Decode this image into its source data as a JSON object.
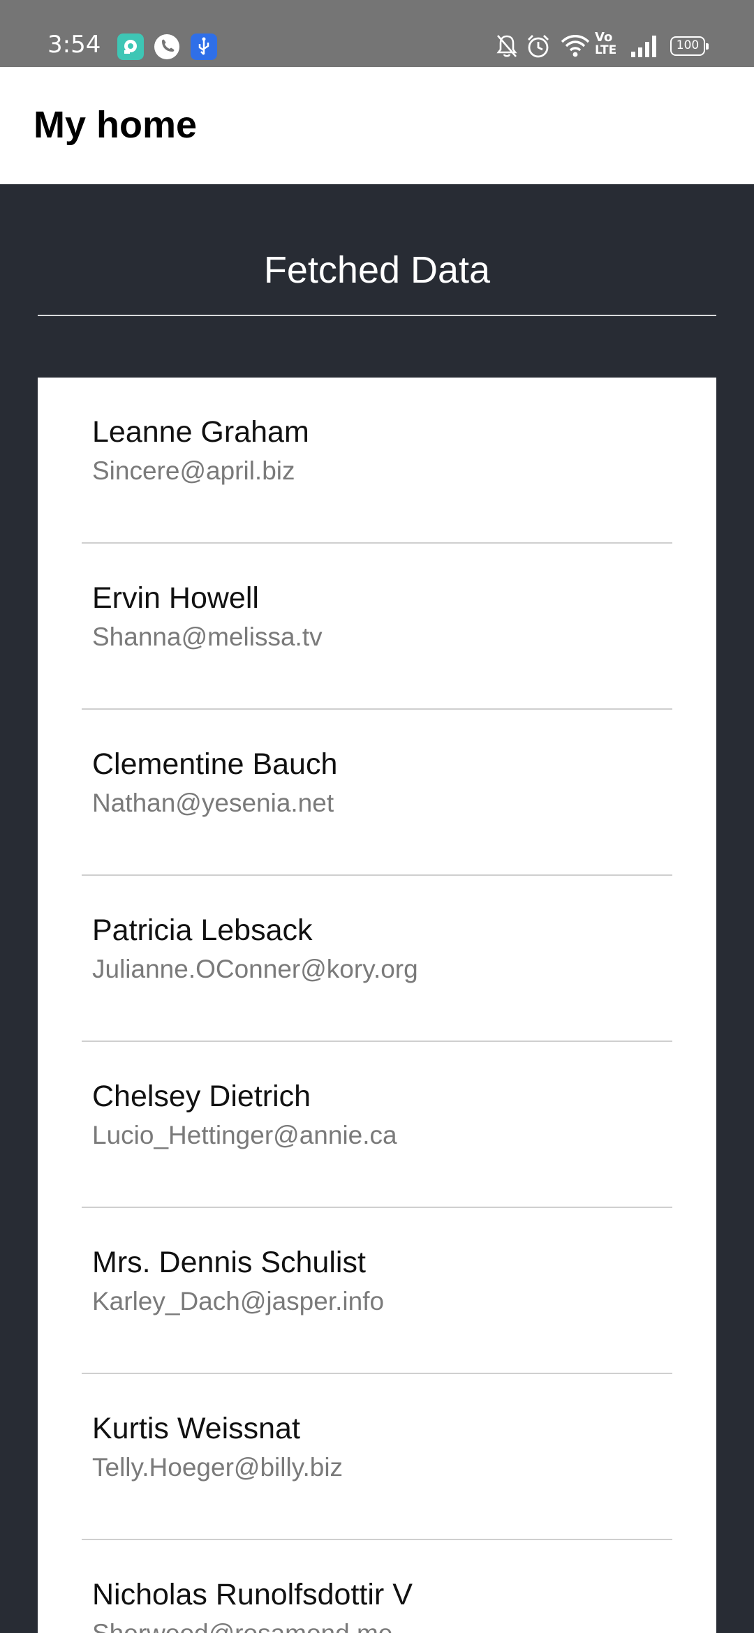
{
  "status_bar": {
    "time": "3:54",
    "notification_icons": [
      "assistant-app-icon",
      "phone-call-icon",
      "usb-debugging-icon"
    ],
    "right_icons": [
      "bell-muted-icon",
      "alarm-clock-icon",
      "wifi-icon",
      "volte-icon",
      "cell-signal-icon",
      "battery-icon"
    ],
    "volte_text_top": "Vo",
    "volte_text_bottom": "LTE",
    "battery_level": "100"
  },
  "app_bar": {
    "title": "My home"
  },
  "content": {
    "section_title": "Fetched Data",
    "users": [
      {
        "name": "Leanne Graham",
        "email": "Sincere@april.biz"
      },
      {
        "name": "Ervin Howell",
        "email": "Shanna@melissa.tv"
      },
      {
        "name": "Clementine Bauch",
        "email": "Nathan@yesenia.net"
      },
      {
        "name": "Patricia Lebsack",
        "email": "Julianne.OConner@kory.org"
      },
      {
        "name": "Chelsey Dietrich",
        "email": "Lucio_Hettinger@annie.ca"
      },
      {
        "name": "Mrs. Dennis Schulist",
        "email": "Karley_Dach@jasper.info"
      },
      {
        "name": "Kurtis Weissnat",
        "email": "Telly.Hoeger@billy.biz"
      },
      {
        "name": "Nicholas Runolfsdottir V",
        "email": "Sherwood@rosamond.me"
      }
    ]
  },
  "colors": {
    "status_bar_bg": "#757575",
    "app_bar_bg": "#ffffff",
    "content_bg": "#282c34",
    "card_bg": "#ffffff",
    "email_text": "#7a7a7a"
  }
}
